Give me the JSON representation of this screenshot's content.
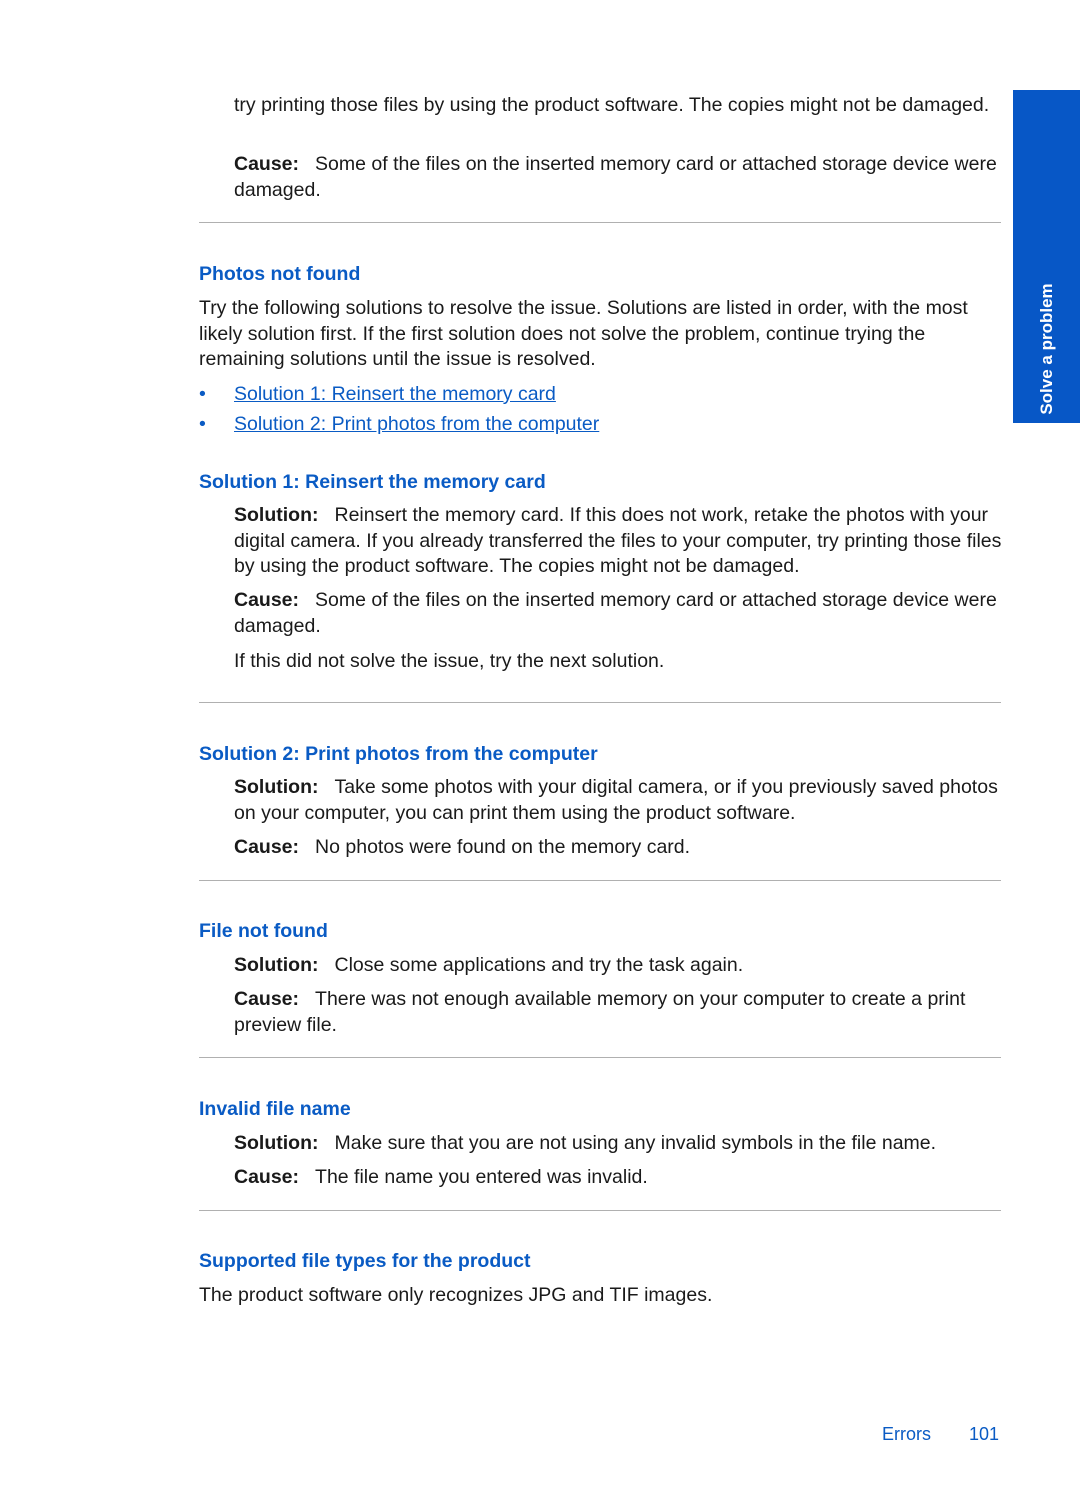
{
  "side_tab": {
    "label": "Solve a problem",
    "color": "#0757c6"
  },
  "intro": {
    "continuation": "try printing those files by using the product software. The copies might not be damaged.",
    "cause_label": "Cause:",
    "cause_text": "Some of the files on the inserted memory card or attached storage device were damaged."
  },
  "photos_not_found": {
    "heading": "Photos not found",
    "intro": "Try the following solutions to resolve the issue. Solutions are listed in order, with the most likely solution first. If the first solution does not solve the problem, continue trying the remaining solutions until the issue is resolved.",
    "links": [
      {
        "bullet": "•",
        "label": "Solution 1: Reinsert the memory card"
      },
      {
        "bullet": "•",
        "label": "Solution 2: Print photos from the computer"
      }
    ]
  },
  "solution1": {
    "heading": "Solution 1: Reinsert the memory card",
    "solution_label": "Solution:",
    "solution_text": "Reinsert the memory card. If this does not work, retake the photos with your digital camera. If you already transferred the files to your computer, try printing those files by using the product software. The copies might not be damaged.",
    "cause_label": "Cause:",
    "cause_text": "Some of the files on the inserted memory card or attached storage device were damaged.",
    "next": "If this did not solve the issue, try the next solution."
  },
  "solution2": {
    "heading": "Solution 2: Print photos from the computer",
    "solution_label": "Solution:",
    "solution_text": "Take some photos with your digital camera, or if you previously saved photos on your computer, you can print them using the product software.",
    "cause_label": "Cause:",
    "cause_text": "No photos were found on the memory card."
  },
  "file_not_found": {
    "heading": "File not found",
    "solution_label": "Solution:",
    "solution_text": "Close some applications and try the task again.",
    "cause_label": "Cause:",
    "cause_text": "There was not enough available memory on your computer to create a print preview file."
  },
  "invalid_file_name": {
    "heading": "Invalid file name",
    "solution_label": "Solution:",
    "solution_text": "Make sure that you are not using any invalid symbols in the file name.",
    "cause_label": "Cause:",
    "cause_text": "The file name you entered was invalid."
  },
  "supported_types": {
    "heading": "Supported file types for the product",
    "text": "The product software only recognizes JPG and TIF images."
  },
  "footer": {
    "section": "Errors",
    "page_number": "101"
  }
}
